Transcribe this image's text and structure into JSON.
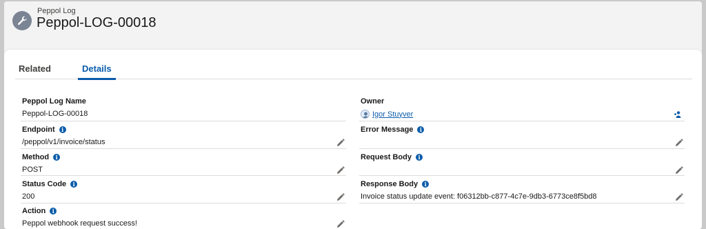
{
  "header": {
    "object_label": "Peppol Log",
    "record_title": "Peppol-LOG-00018",
    "icon": "wrench-icon"
  },
  "tabs": [
    {
      "label": "Related",
      "active": false
    },
    {
      "label": "Details",
      "active": true
    }
  ],
  "fields_left": {
    "name": {
      "label": "Peppol Log Name",
      "value": "Peppol-LOG-00018"
    },
    "endpoint": {
      "label": "Endpoint",
      "value": "/peppol/v1/invoice/status"
    },
    "method": {
      "label": "Method",
      "value": "POST"
    },
    "status_code": {
      "label": "Status Code",
      "value": "200"
    },
    "action": {
      "label": "Action",
      "value": "Peppol webhook request success!"
    }
  },
  "fields_right": {
    "owner": {
      "label": "Owner",
      "value": "Igor Stuyver"
    },
    "error_message": {
      "label": "Error Message",
      "value": ""
    },
    "request_body": {
      "label": "Request Body",
      "value": ""
    },
    "response_body": {
      "label": "Response Body",
      "value": "Invoice status update event: f06312bb-c877-4c7e-9db3-6773ce8f5bd8"
    }
  },
  "colors": {
    "brand_blue": "#0b5cab",
    "header_bg": "#f3f3f3",
    "icon_gray": "#7a8493",
    "divider": "#dddbda"
  }
}
